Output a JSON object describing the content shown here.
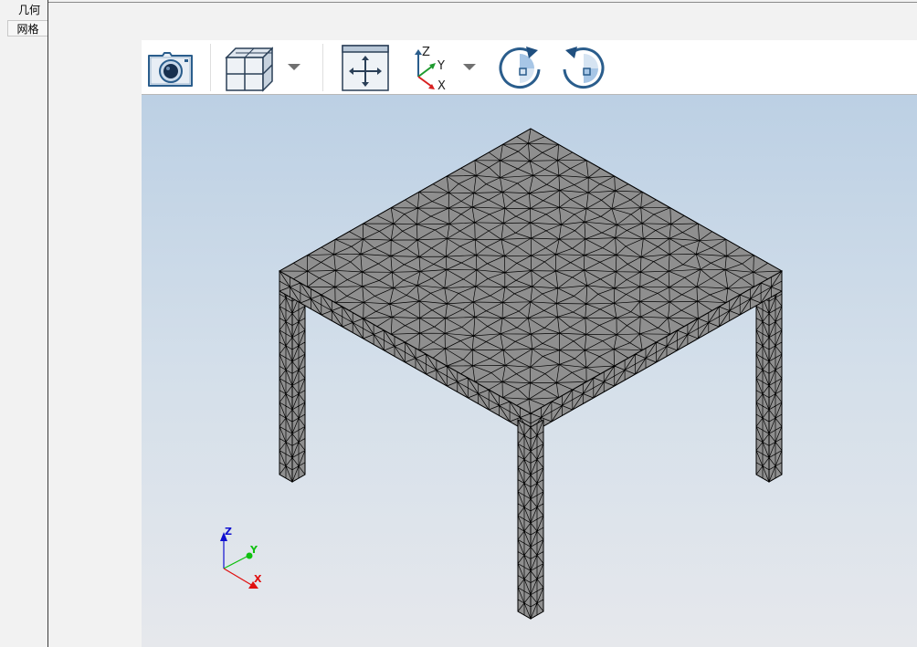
{
  "side_tabs": {
    "geometry": "几何",
    "mesh": "网格"
  },
  "toolbar": {
    "items": [
      {
        "name": "screenshot",
        "icon": "camera-icon"
      },
      {
        "name": "view-cube",
        "icon": "cube-icon",
        "has_dropdown": true
      },
      {
        "name": "zoom-extents",
        "icon": "fit-view-icon"
      },
      {
        "name": "axis-view",
        "icon": "axis-icon",
        "has_dropdown": true,
        "labels": [
          "Z",
          "Y",
          "X"
        ]
      },
      {
        "name": "rotate-clockwise",
        "icon": "rotate-cw-icon"
      },
      {
        "name": "rotate-counterclockwise",
        "icon": "rotate-ccw-icon"
      }
    ]
  },
  "triad": {
    "z_label": "Z",
    "y_label": "Y",
    "x_label": "X",
    "colors": {
      "x": "#e01010",
      "y": "#10c010",
      "z": "#1010d0"
    }
  },
  "colors": {
    "mesh_fill": "#8f8f8f",
    "mesh_edge": "#000000",
    "icon_blue": "#2a5d8c",
    "bg_top": "#bcd0e4",
    "bg_bottom": "#e6e8ec"
  }
}
